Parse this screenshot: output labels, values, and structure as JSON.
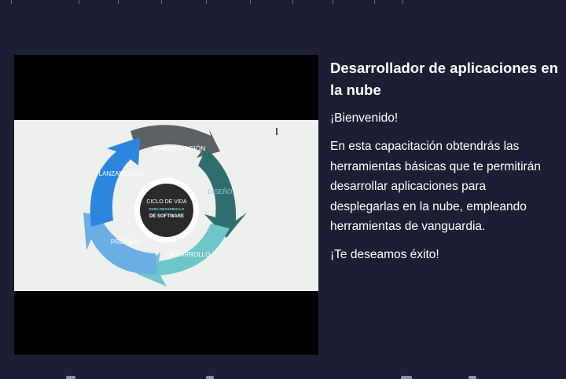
{
  "course": {
    "title": "Desarrollador de aplicaciones en la nube",
    "welcome": "¡Bienvenido!",
    "description": "En esta capacitación obtendrás las herramientas básicas que te permitirán desarrollar aplicaciones para desplegarlas en la nube, empleando herramientas de vanguardia.",
    "closing": "¡Te deseamos éxito!"
  },
  "video": {
    "diagram": {
      "center_line1": "CICLO DE VIDA",
      "center_line2": "PARA DESARROLLO",
      "center_line3": "DE SOFTWARE",
      "stages": [
        "INVESTIGACIÓN",
        "DISEÑO",
        "DESARROLLO",
        "PRUEBAS",
        "LANZAMIENTO"
      ]
    }
  },
  "colors": {
    "background": "#1c1f33",
    "stage_investigacion": "#5d6166",
    "stage_diseno": "#2f6e6e",
    "stage_desarrollo": "#6fc6c8",
    "stage_pruebas": "#6aaee6",
    "stage_lanzamiento": "#2c86e0",
    "center": "#2a2a2c"
  }
}
